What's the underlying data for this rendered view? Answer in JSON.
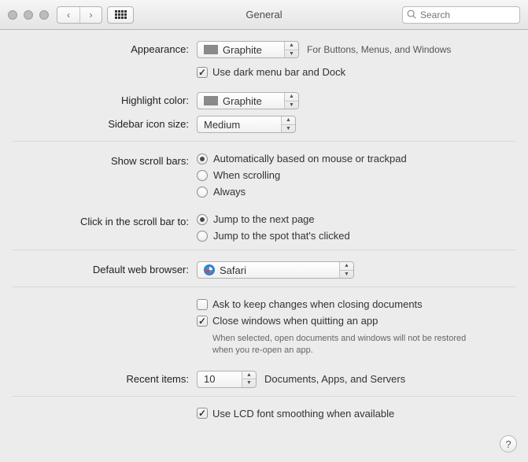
{
  "window": {
    "title": "General"
  },
  "search": {
    "placeholder": "Search"
  },
  "labels": {
    "appearance": "Appearance:",
    "highlight": "Highlight color:",
    "sidebar": "Sidebar icon size:",
    "scrollbars": "Show scroll bars:",
    "clickscroll": "Click in the scroll bar to:",
    "browser": "Default web browser:",
    "recent": "Recent items:"
  },
  "appearance": {
    "value": "Graphite",
    "hint": "For Buttons, Menus, and Windows",
    "darkmenu": {
      "label": "Use dark menu bar and Dock",
      "checked": true
    }
  },
  "highlight": {
    "value": "Graphite"
  },
  "sidebar": {
    "value": "Medium"
  },
  "scrollbars": {
    "options": [
      {
        "label": "Automatically based on mouse or trackpad",
        "selected": true
      },
      {
        "label": "When scrolling",
        "selected": false
      },
      {
        "label": "Always",
        "selected": false
      }
    ]
  },
  "clickscroll": {
    "options": [
      {
        "label": "Jump to the next page",
        "selected": true
      },
      {
        "label": "Jump to the spot that's clicked",
        "selected": false
      }
    ]
  },
  "browser": {
    "value": "Safari"
  },
  "documents": {
    "ask": {
      "label": "Ask to keep changes when closing documents",
      "checked": false
    },
    "close": {
      "label": "Close windows when quitting an app",
      "checked": true
    },
    "close_hint": "When selected, open documents and windows will not be restored when you re-open an app."
  },
  "recent": {
    "value": "10",
    "suffix": "Documents, Apps, and Servers"
  },
  "lcd": {
    "label": "Use LCD font smoothing when available",
    "checked": true
  }
}
